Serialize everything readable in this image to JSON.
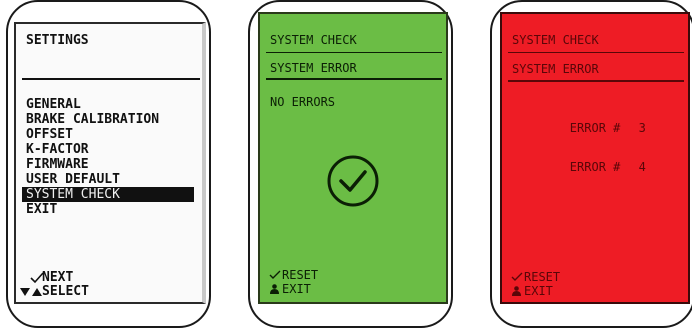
{
  "settings_screen": {
    "title": "SETTINGS",
    "menu_items": [
      {
        "label": "GENERAL",
        "selected": false
      },
      {
        "label": "BRAKE CALIBRATION",
        "selected": false
      },
      {
        "label": "OFFSET",
        "selected": false
      },
      {
        "label": "K-FACTOR",
        "selected": false
      },
      {
        "label": "FIRMWARE",
        "selected": false
      },
      {
        "label": "USER DEFAULT",
        "selected": false
      },
      {
        "label": "SYSTEM CHECK",
        "selected": true
      },
      {
        "label": "EXIT",
        "selected": false
      }
    ],
    "footer": {
      "next_label": "NEXT",
      "select_label": "SELECT",
      "next_icon": "check-icon",
      "select_icon": "up-down-triangles-icon"
    }
  },
  "system_ok_screen": {
    "background_color": "#6bbd45",
    "title": "SYSTEM CHECK",
    "subtitle": "SYSTEM ERROR",
    "status": "NO ERRORS",
    "status_icon": "check-circle-icon",
    "footer": {
      "reset_label": "RESET",
      "exit_label": "EXIT",
      "reset_icon": "check-icon",
      "exit_icon": "person-icon"
    }
  },
  "system_error_screen": {
    "background_color": "#ee1c25",
    "title": "SYSTEM CHECK",
    "subtitle": "SYSTEM ERROR",
    "errors": [
      {
        "label": "ERROR #",
        "number": "3"
      },
      {
        "label": "ERROR #",
        "number": "4"
      }
    ],
    "footer": {
      "reset_label": "RESET",
      "exit_label": "EXIT",
      "reset_icon": "check-icon",
      "exit_icon": "person-icon"
    }
  }
}
